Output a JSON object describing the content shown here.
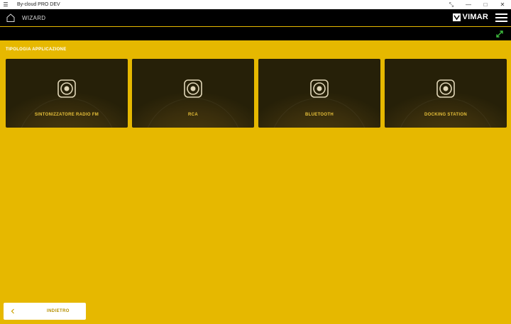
{
  "window": {
    "title": "By-cloud PRO DEV",
    "controls": [
      "expand-icon",
      "minimize-icon",
      "maximize-icon",
      "close-icon"
    ]
  },
  "header": {
    "title": "WIZARD",
    "brand": "VIMAR"
  },
  "section": {
    "label": "TIPOLOGIA APPLICAZIONE"
  },
  "cards": [
    {
      "label": "SINTONIZZATORE RADIO FM",
      "icon": "speaker-icon"
    },
    {
      "label": "RCA",
      "icon": "speaker-icon"
    },
    {
      "label": "BLUETOOTH",
      "icon": "speaker-icon"
    },
    {
      "label": "DOCKING STATION",
      "icon": "speaker-icon"
    }
  ],
  "footer": {
    "back_label": "INDIETRO"
  },
  "colors": {
    "background": "#e6b800",
    "card": "#2e250a",
    "card_text": "#e8c13a",
    "accent_green": "#3fbf3f"
  }
}
